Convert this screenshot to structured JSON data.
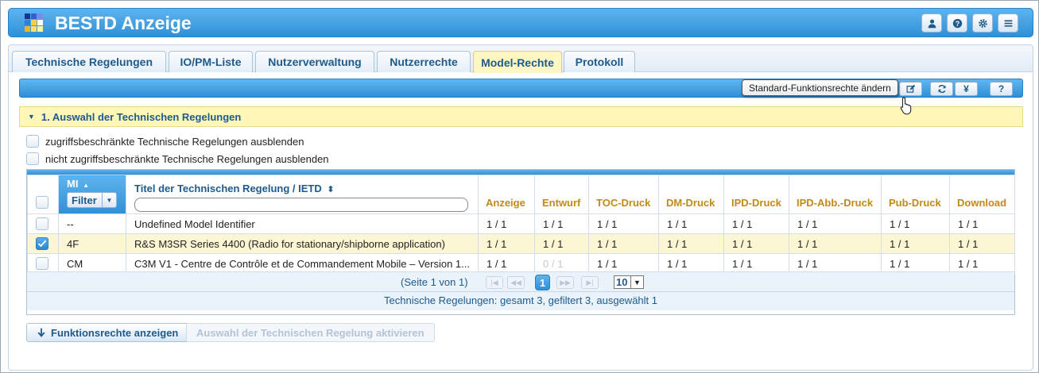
{
  "app": {
    "title": "BESTD Anzeige"
  },
  "header_buttons": [
    {
      "name": "user-icon"
    },
    {
      "name": "help-icon"
    },
    {
      "name": "gear-icon"
    },
    {
      "name": "menu-icon"
    }
  ],
  "tabs": [
    {
      "label": "Technische Regelungen",
      "active": false
    },
    {
      "label": "IO/PM-Liste",
      "active": false
    },
    {
      "label": "Nutzerverwaltung",
      "active": false
    },
    {
      "label": "Nutzerrechte",
      "active": false
    },
    {
      "label": "Model-Rechte",
      "active": true
    },
    {
      "label": "Protokoll",
      "active": false
    }
  ],
  "toolbar": {
    "tooltip": "Standard-Funktionsrechte ändern",
    "yen_label": "¥",
    "help_label": "?"
  },
  "section": {
    "title": "1. Auswahl der Technischen Regelungen"
  },
  "options": {
    "hide_restricted": "zugriffsbeschränkte Technische Regelungen ausblenden",
    "hide_unrestricted": "nicht zugriffsbeschränkte Technische Regelungen ausblenden"
  },
  "grid": {
    "col_mi": "MI",
    "sort_up": "▲",
    "filter_label": "Filter",
    "col_title": "Titel der Technischen Regelung / IETD",
    "sort_both": "⬍",
    "columns": [
      "Anzeige",
      "Entwurf",
      "TOC-Druck",
      "DM-Druck",
      "IPD-Druck",
      "IPD-Abb.-Druck",
      "Pub-Druck",
      "Download"
    ],
    "rows": [
      {
        "checked": false,
        "mi": "--",
        "title": "Undefined Model Identifier",
        "values": [
          "1 / 1",
          "1 / 1",
          "1 / 1",
          "1 / 1",
          "1 / 1",
          "1 / 1",
          "1 / 1",
          "1 / 1"
        ]
      },
      {
        "checked": true,
        "mi": "4F",
        "title": "R&S M3SR Series 4400 (Radio for stationary/shipborne application)",
        "values": [
          "1 / 1",
          "1 / 1",
          "1 / 1",
          "1 / 1",
          "1 / 1",
          "1 / 1",
          "1 / 1",
          "1 / 1"
        ]
      },
      {
        "checked": false,
        "mi": "CM",
        "title": "C3M V1 - Centre de Contrôle et de Commandement Mobile – Version 1...",
        "values": [
          "1 / 1",
          "0 / 1",
          "1 / 1",
          "1 / 1",
          "1 / 1",
          "1 / 1",
          "1 / 1",
          "1 / 1"
        ]
      }
    ],
    "pager": {
      "text": "(Seite 1 von 1)",
      "current_page": "1",
      "page_size": "10"
    },
    "summary": "Technische Regelungen: gesamt 3, gefiltert 3, ausgewählt 1"
  },
  "buttons": {
    "show_rights": "Funktionsrechte anzeigen",
    "activate": "Auswahl der Technischen Regelung aktivieren"
  },
  "colors": {
    "accent": "#2f90d8",
    "header_text": "#c08a1b",
    "link": "#1e5a8c",
    "selection": "#fff7c2"
  }
}
